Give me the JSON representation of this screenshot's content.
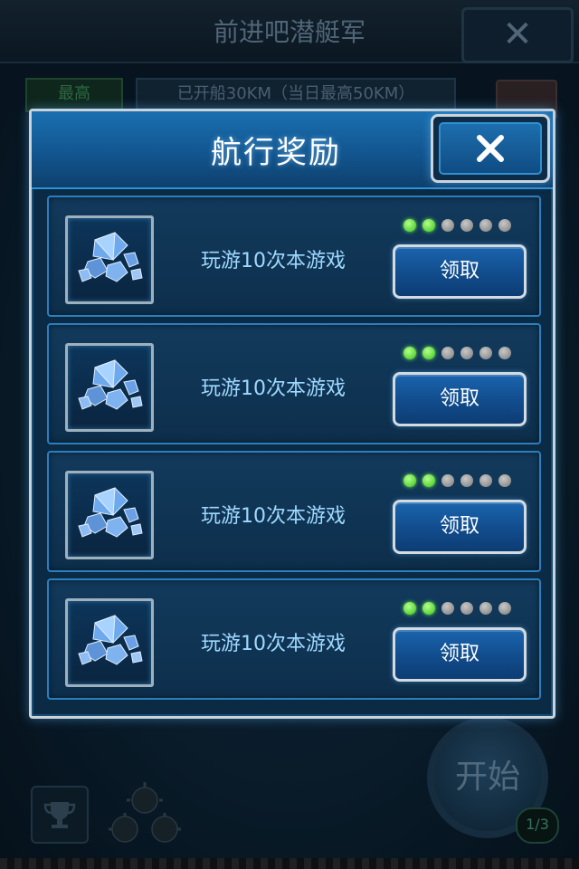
{
  "background": {
    "title": "前进吧潜艇军",
    "close_glyph": "✕",
    "best_label": "最高",
    "distance_text": "已开船30KM（当日最高50KM）",
    "start_label": "开始",
    "page_indicator": "1/3"
  },
  "dialog": {
    "title": "航行奖励",
    "close_glyph": "✕",
    "rows": [
      {
        "label": "玩游10次本游戏",
        "button": "领取",
        "progress_done": 2,
        "progress_total": 6,
        "icon": "diamonds-icon"
      },
      {
        "label": "玩游10次本游戏",
        "button": "领取",
        "progress_done": 2,
        "progress_total": 6,
        "icon": "diamonds-icon"
      },
      {
        "label": "玩游10次本游戏",
        "button": "领取",
        "progress_done": 2,
        "progress_total": 6,
        "icon": "diamonds-icon"
      },
      {
        "label": "玩游10次本游戏",
        "button": "领取",
        "progress_done": 2,
        "progress_total": 6,
        "icon": "diamonds-icon"
      }
    ]
  },
  "colors": {
    "dot_on": "#38c21a",
    "dot_off": "#7a7a7a",
    "accent": "#1a6fb0"
  }
}
